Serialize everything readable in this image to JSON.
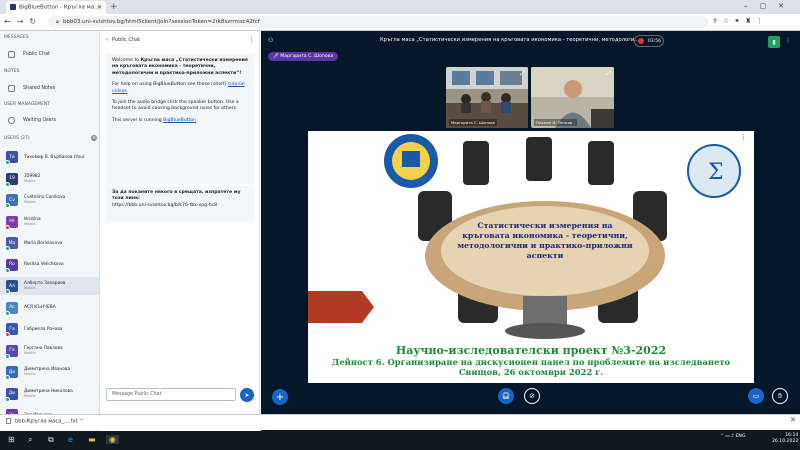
{
  "browser": {
    "tab_title": "BigBlueButton - Кръгла ма...",
    "url": "bbb03.uni-svishtov.bg/html5client/join?sessionToken=2rk8szrrmsc42fcf"
  },
  "sidebar": {
    "messages_header": "MESSAGES",
    "public_chat": "Public Chat",
    "notes_header": "NOTES",
    "shared_notes": "Shared Notes",
    "user_mgmt_header": "USER MANAGEMENT",
    "waiting_users": "Waiting Users",
    "users_header": "USERS (27)",
    "users": [
      {
        "initials": "Тв",
        "name": "Тихомир В. Върбанов (You)",
        "sub": "",
        "color": "#3a4fa8",
        "mic": "green"
      },
      {
        "initials": "19",
        "name": "359982",
        "sub": "Mobile",
        "color": "#2c3e7a",
        "mic": "green"
      },
      {
        "initials": "Cv",
        "name": "Cvetelina Canikova",
        "sub": "Mobile",
        "color": "#3f6fb6",
        "mic": "green"
      },
      {
        "initials": "Hr",
        "name": "Hristina",
        "sub": "Mobile",
        "color": "#7b3fa8",
        "mic": "red"
      },
      {
        "initials": "Ma",
        "name": "Maria Borislavova",
        "sub": "",
        "color": "#4a5ba8",
        "mic": "green"
      },
      {
        "initials": "Ro",
        "name": "Rositsa Velichkova",
        "sub": "",
        "color": "#5a3aa0",
        "mic": "green"
      },
      {
        "initials": "Ал",
        "name": "Алберто Захариев",
        "sub": "Mobile",
        "color": "#2e4f8f",
        "mic": "green"
      },
      {
        "initials": "Ас",
        "name": "АСЯ КЪНЧЕВА",
        "sub": "",
        "color": "#4a86c8",
        "mic": "green"
      },
      {
        "initials": "Га",
        "name": "Габриела Рачова",
        "sub": "",
        "color": "#3a57b0",
        "mic": "red"
      },
      {
        "initials": "Ге",
        "name": "Гергана Павлова",
        "sub": "Mobile",
        "color": "#5b48b0",
        "mic": "green"
      },
      {
        "initials": "Ди",
        "name": "Димитрина Иванова",
        "sub": "Mobile",
        "color": "#3a6ab8",
        "mic": "green"
      },
      {
        "initials": "Ди",
        "name": "Димитрина Николова",
        "sub": "Mobile",
        "color": "#3b4fa0",
        "mic": "green"
      },
      {
        "initials": "Зо",
        "name": "Зоя Иванова",
        "sub": "",
        "color": "#6a3aa8",
        "mic": "green"
      }
    ]
  },
  "chat": {
    "header": "Public Chat",
    "welcome_prefix": "Welcome to ",
    "welcome_title": "Кръгла маса „Статистически измерения на кръговата икономика - теоретични, методологични и практико-приложни аспекти“!",
    "help_text": "For help on using BigBlueButton see these (short) ",
    "help_link": "tutorial videos",
    "audio_text": "To join the audio bridge click the speaker button. Use a headset to avoid causing background noise for others.",
    "server_text": "This server is running ",
    "server_link": "BigBlueButton",
    "invite_text": "За да поканите някого в срещата, изпратете му този линк:",
    "invite_link": "https://bbb.uni-svishtov.bg/b/k76-tbx-vpg-hc8",
    "input_placeholder": "Message Public Chat"
  },
  "meeting": {
    "title": "Кръгла маса „Статистически измерения на кръговата икономика - теоретични, методологи...",
    "recording_time": "03:56",
    "speaker": "Маргарита С. Шопова",
    "cams": [
      {
        "label": "Маргарита С. Шопова"
      },
      {
        "label": "Пламен И. Петков -"
      }
    ]
  },
  "slide": {
    "title": "Статистически измерения на кръговата икономика - теоретични, методологични и практико-приложни аспекти",
    "line1": "Научно-изследователски проект №3-2022",
    "line2": "Дейност 6. Организиране на дискусионен панел по проблемите на изследването",
    "line3": "Свищов, 26 октомври 2022 г."
  },
  "downloads": {
    "file": "bbb-Кръгла маса_....txt"
  },
  "taskbar": {
    "lang": "ENG",
    "time": "16:14",
    "date": "26.10.2022"
  },
  "colors": {
    "main_bg": "#06172a",
    "accent_blue": "#1b62c4",
    "speaker_purple": "#5a35a8",
    "slide_green": "#1d8a3a",
    "slide_title_blue": "#1e2a78"
  }
}
